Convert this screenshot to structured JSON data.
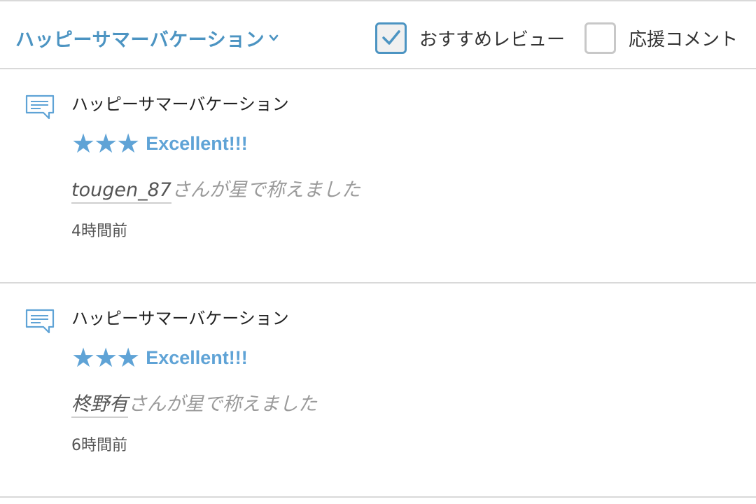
{
  "header": {
    "title": "ハッピーサマーバケーション",
    "filters": {
      "recommended": {
        "label": "おすすめレビュー",
        "checked": true
      },
      "support": {
        "label": "応援コメント",
        "checked": false
      }
    }
  },
  "reviews": [
    {
      "title": "ハッピーサマーバケーション",
      "stars": "★★★",
      "star_count": 3,
      "rating_text": "Excellent!!!",
      "user": "tougen_87",
      "praise_suffix": "さんが星で称えました",
      "time": "4時間前"
    },
    {
      "title": "ハッピーサマーバケーション",
      "stars": "★★★",
      "star_count": 3,
      "rating_text": "Excellent!!!",
      "user": "柊野有",
      "praise_suffix": "さんが星で称えました",
      "time": "6時間前"
    }
  ],
  "colors": {
    "accent": "#4c94c2",
    "star": "#5fa3d6",
    "divider": "#d9d9d9"
  }
}
